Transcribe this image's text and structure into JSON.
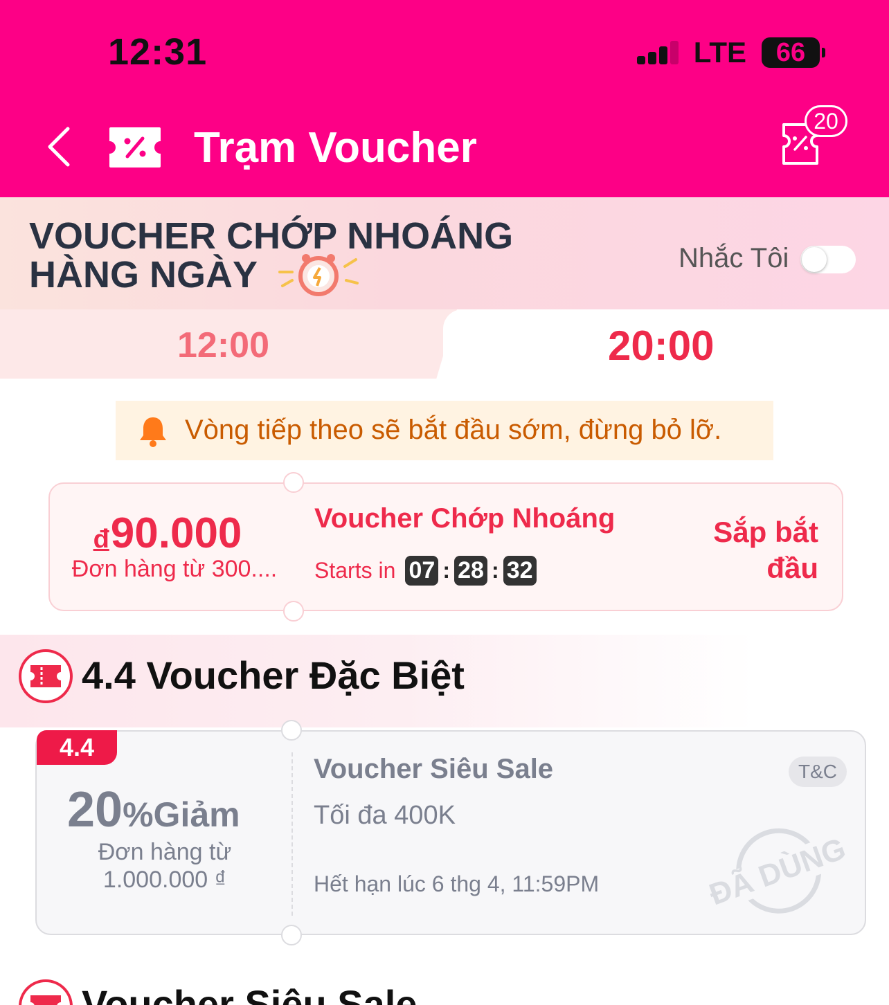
{
  "status_bar": {
    "time": "12:31",
    "network": "LTE",
    "battery": "66"
  },
  "header": {
    "title": "Trạm Voucher",
    "wallet_badge": "20"
  },
  "banner": {
    "title_line1": "VOUCHER CHỚP NHOÁNG",
    "title_line2": "HÀNG NGÀY",
    "remind_label": "Nhắc Tôi",
    "remind_on": false
  },
  "time_tabs": [
    {
      "label": "12:00",
      "active": false
    },
    {
      "label": "20:00",
      "active": true
    }
  ],
  "notice": {
    "text": "Vòng tiếp theo sẽ bắt đầu sớm, đừng bỏ lỡ."
  },
  "flash_voucher": {
    "currency": "đ",
    "amount": "90.000",
    "min_order": "Đơn hàng từ 300....",
    "name": "Voucher Chớp Nhoáng",
    "starts_label": "Starts in",
    "countdown": {
      "h": "07",
      "m": "28",
      "s": "32"
    },
    "status_line1": "Sắp bắt",
    "status_line2": "đầu"
  },
  "special_section": {
    "title": "4.4 Voucher Đặc Biệt",
    "voucher": {
      "tag": "4.4",
      "percent": "20",
      "percent_suffix": "%Giảm",
      "min_order_line1": "Đơn hàng từ",
      "min_order_line2": "1.000.000 ₫",
      "name": "Voucher Siêu Sale",
      "max": "Tối đa 400K",
      "expiry": "Hết hạn lúc 6 thg 4, 11:59PM",
      "tc": "T&C",
      "stamp": "ĐÃ DÙNG"
    }
  },
  "next_section": {
    "title": "Voucher Siêu Sale"
  },
  "colors": {
    "brand": "#fd0086",
    "accent": "#ee2a4b",
    "muted": "#7a7f8e",
    "notice": "#c95b00"
  }
}
